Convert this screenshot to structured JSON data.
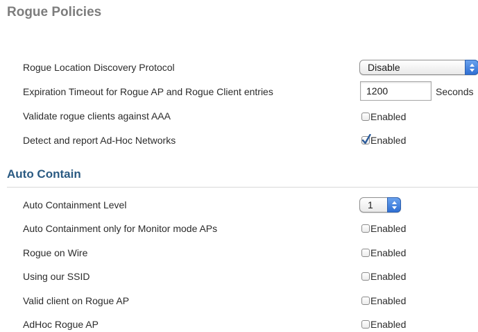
{
  "page": {
    "title": "Rogue Policies"
  },
  "rogue_policies": {
    "rldp": {
      "label": "Rogue Location Discovery Protocol",
      "value": "Disable"
    },
    "expiration": {
      "label": "Expiration Timeout for Rogue AP and Rogue Client entries",
      "value": "1200",
      "unit": "Seconds"
    },
    "validate_aaa": {
      "label": "Validate rogue clients against AAA",
      "option": "Enabled",
      "checked": false
    },
    "adhoc_detect": {
      "label": "Detect and report Ad-Hoc Networks",
      "option": "Enabled",
      "checked": true
    }
  },
  "auto_contain": {
    "title": "Auto Contain",
    "level": {
      "label": "Auto Containment Level",
      "value": "1"
    },
    "monitor_only": {
      "label": "Auto Containment only for Monitor mode APs",
      "option": "Enabled",
      "checked": false
    },
    "rogue_on_wire": {
      "label": "Rogue on Wire",
      "option": "Enabled",
      "checked": false
    },
    "using_ssid": {
      "label": "Using our SSID",
      "option": "Enabled",
      "checked": false
    },
    "valid_client": {
      "label": "Valid client on Rogue AP",
      "option": "Enabled",
      "checked": false
    },
    "adhoc_ap": {
      "label": "AdHoc Rogue AP",
      "option": "Enabled",
      "checked": false
    }
  },
  "icons": {
    "select_arrows": "updown-arrows-icon",
    "check": "checkmark-icon"
  },
  "colors": {
    "section_title": "#2a5a82",
    "page_title": "#7d7d7d",
    "stepper": "#2f6fd3",
    "check": "#2a5a9a"
  }
}
